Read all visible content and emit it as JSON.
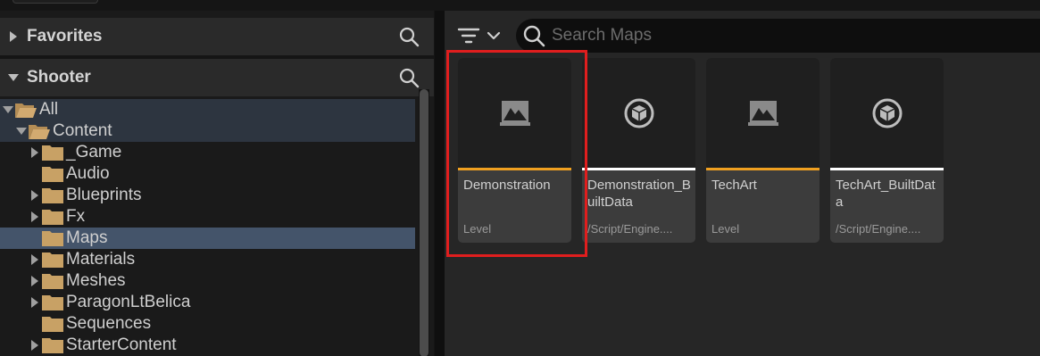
{
  "left_panel": {
    "favorites": {
      "label": "Favorites"
    },
    "project": {
      "label": "Shooter"
    },
    "tree": [
      {
        "label": "All"
      },
      {
        "label": "Content"
      },
      {
        "label": "_Game"
      },
      {
        "label": "Audio"
      },
      {
        "label": "Blueprints"
      },
      {
        "label": "Fx"
      },
      {
        "label": "Maps"
      },
      {
        "label": "Materials"
      },
      {
        "label": "Meshes"
      },
      {
        "label": "ParagonLtBelica"
      },
      {
        "label": "Sequences"
      },
      {
        "label": "StarterContent"
      }
    ]
  },
  "asset_view": {
    "search": {
      "placeholder": "Search Maps",
      "value": ""
    },
    "assets": [
      {
        "name": "Demonstration",
        "type": "Level",
        "icon": "level-icon",
        "accent": "#f0a020"
      },
      {
        "name": "Demonstration_BuiltData",
        "type": "/Script/Engine....",
        "icon": "built-data-icon",
        "accent": "#ffffff"
      },
      {
        "name": "TechArt",
        "type": "Level",
        "icon": "level-icon",
        "accent": "#f0a020"
      },
      {
        "name": "TechArt_BuiltData",
        "type": "/Script/Engine....",
        "icon": "built-data-icon",
        "accent": "#ffffff"
      }
    ]
  },
  "colors": {
    "selection": "#44546a",
    "folder": "#c8a165",
    "highlight_box": "#e01e1e",
    "level_accent": "#f0a020"
  }
}
